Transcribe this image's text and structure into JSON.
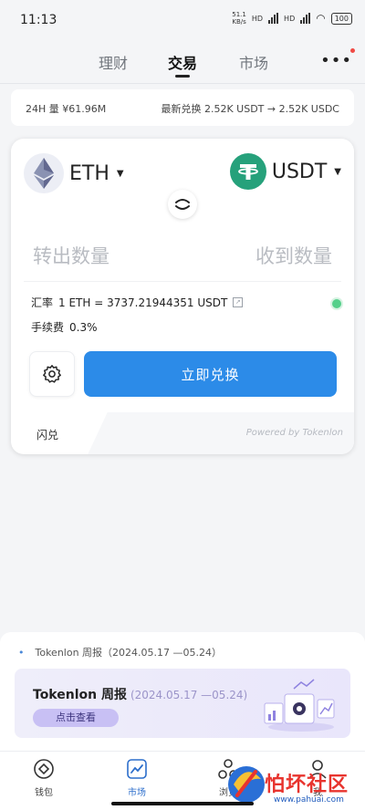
{
  "status_bar": {
    "time": "11:13",
    "speed_value": "51.1",
    "speed_unit": "KB/s",
    "network_1": "HD",
    "network_2": "HD",
    "battery": "100"
  },
  "top_nav": {
    "tabs": [
      {
        "label": "理财",
        "active": false
      },
      {
        "label": "交易",
        "active": true
      },
      {
        "label": "市场",
        "active": false
      }
    ],
    "more_label": "•••"
  },
  "ticker": {
    "volume_text": "24H 量 ¥61.96M",
    "latest_text": "最新兑换 2.52K USDT → 2.52K USDC"
  },
  "swap": {
    "from_token": {
      "symbol": "ETH",
      "icon": "ethereum-icon"
    },
    "to_token": {
      "symbol": "USDT",
      "icon": "tether-icon"
    },
    "swap_toggle_icon": "swap-direction-icon",
    "out_placeholder": "转出数量",
    "in_placeholder": "收到数量",
    "rate_label": "汇率",
    "rate_value": "1 ETH = 3737.21944351 USDT",
    "fee_label": "手续费",
    "fee_value": "0.3%",
    "settings_icon": "gear-icon",
    "swap_button_label": "立即兑换",
    "mode_label": "闪兑",
    "powered_by": "Powered by Tokenlon",
    "status_color": "#54d08a",
    "accent_color": "#2c8be8"
  },
  "news": {
    "ticker_line": "Tokenlon 周报（2024.05.17 —05.24）",
    "card_title": "Tokenlon 周报",
    "card_date": "(2024.05.17 —05.24)",
    "card_cta": "点击查看"
  },
  "bottom_nav": {
    "items": [
      {
        "label": "钱包",
        "icon": "wallet-icon",
        "active": false
      },
      {
        "label": "市场",
        "icon": "trend-chart-icon",
        "active": true
      },
      {
        "label": "浏览",
        "icon": "browser-icon",
        "active": false
      },
      {
        "label": "我",
        "icon": "profile-icon",
        "active": false
      }
    ]
  },
  "watermark": {
    "text": "怕坏社区",
    "url": "www.pahuai.com"
  }
}
